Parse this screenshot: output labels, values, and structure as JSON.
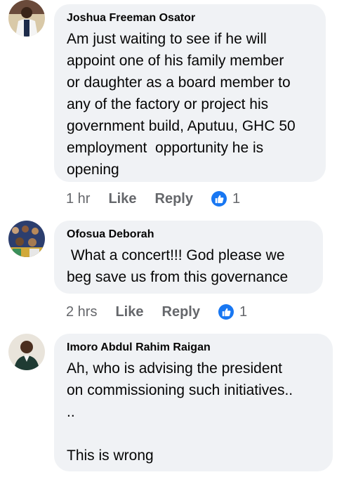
{
  "comments": [
    {
      "author": "Joshua Freeman Osator",
      "text": "Am just waiting to see if he will\nappoint one of his family member\nor daughter as a board member to\nany of the factory or project his\ngovernment build, Aputuu, GHC 50\nemployment  opportunity he is\nopening",
      "time": "1 hr",
      "like_label": "Like",
      "reply_label": "Reply",
      "reaction_count": "1",
      "reaction_icon": "like-thumb-icon"
    },
    {
      "author": "Ofosua Deborah",
      "text": " What a concert!!! God please we\nbeg save us from this governance",
      "time": "2 hrs",
      "like_label": "Like",
      "reply_label": "Reply",
      "reaction_count": "1",
      "reaction_icon": "like-thumb-icon"
    },
    {
      "author": "Imoro Abdul Rahim Raigan",
      "text": "Ah, who is advising the president\non commissioning such initiatives..\n..\n\nThis is wrong"
    }
  ],
  "colors": {
    "bubble": "#f0f2f5",
    "meta_text": "#65676b",
    "like_blue": "#1877f2"
  }
}
